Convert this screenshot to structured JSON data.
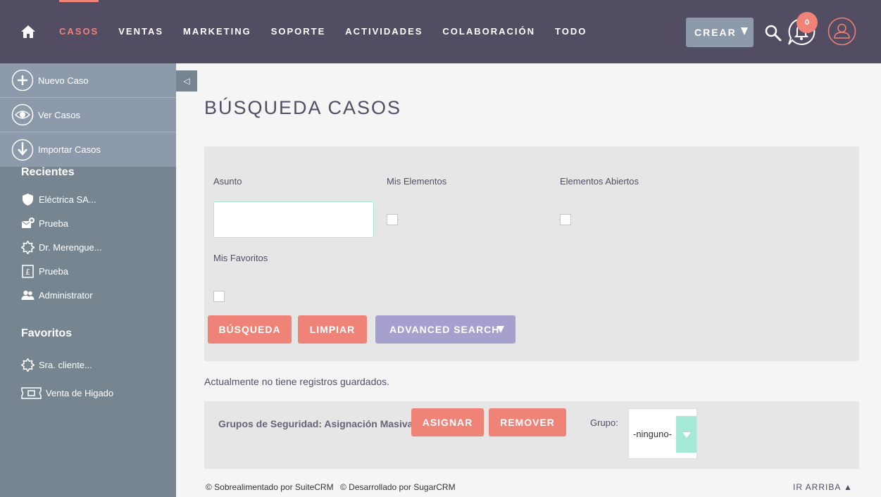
{
  "nav": {
    "items": [
      {
        "label": "CASOS",
        "active": true
      },
      {
        "label": "VENTAS"
      },
      {
        "label": "MARKETING"
      },
      {
        "label": "SOPORTE"
      },
      {
        "label": "ACTIVIDADES"
      },
      {
        "label": "COLABORACIÓN"
      },
      {
        "label": "TODO"
      }
    ],
    "create_label": "CREAR",
    "notification_count": "0"
  },
  "sidebar": {
    "actions": [
      {
        "label": "Nuevo Caso",
        "icon": "plus-circle-icon"
      },
      {
        "label": "Ver Casos",
        "icon": "eye-icon"
      },
      {
        "label": "Importar Casos",
        "icon": "download-arrow-icon"
      }
    ],
    "recent_title": "Recientes",
    "recent": [
      {
        "label": "Eléctrica SA...",
        "icon": "shield-icon"
      },
      {
        "label": "Prueba",
        "icon": "email-plus-icon"
      },
      {
        "label": "Dr. Merengue...",
        "icon": "gear-star-icon"
      },
      {
        "label": "Prueba",
        "icon": "pound-document-icon"
      },
      {
        "label": "Administrator",
        "icon": "users-icon"
      }
    ],
    "favorites_title": "Favoritos",
    "favorites": [
      {
        "label": "Sra. cliente...",
        "icon": "gear-star-icon"
      },
      {
        "label": "Venta de Higado",
        "icon": "ticket-icon"
      }
    ]
  },
  "main": {
    "title": "BÚSQUEDA CASOS",
    "fields": {
      "asunto": "Asunto",
      "mis_elementos": "Mis Elementos",
      "elementos_abiertos": "Elementos Abiertos",
      "mis_favoritos": "Mis Favoritos",
      "asunto_value": ""
    },
    "buttons": {
      "search": "BÚSQUEDA",
      "clear": "LIMPIAR",
      "advanced": "ADVANCED SEARCH"
    },
    "saved_message": "Actualmente no tiene registros guardados.",
    "mass": {
      "label": "Grupos de Seguridad: Asignación Masiva",
      "assign": "ASIGNAR",
      "remove": "REMOVER",
      "group_label": "Grupo:",
      "group_value": "-ninguno-"
    }
  },
  "footer": {
    "powered": "© Sobrealimentado por SuiteCRM",
    "developed": "© Desarrollado por SugarCRM",
    "back_to_top": "IR ARRIBA ▲"
  },
  "colors": {
    "nav_bg": "#534d64",
    "accent": "#f08377",
    "sidebar_bg": "#778591",
    "sidebar_actions_bg": "#8d9aab",
    "advanced_btn": "#a5a0cd",
    "input_border": "#a5e8d6"
  }
}
